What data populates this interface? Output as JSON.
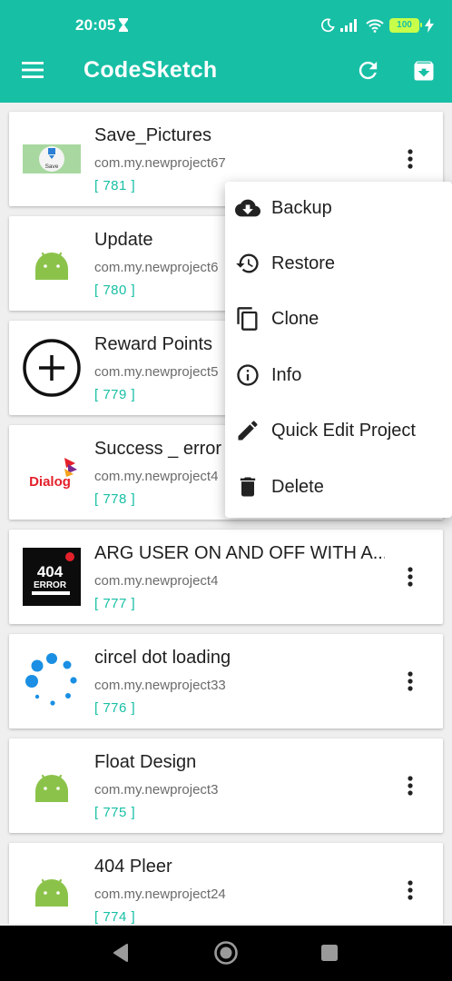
{
  "status": {
    "time": "20:05",
    "battery": "100"
  },
  "app": {
    "title": "CodeSketch"
  },
  "projects": [
    {
      "name": "Save_Pictures",
      "pkg": "com.my.newproject67",
      "id": "[ 781 ]",
      "icon": "save-picture-thumb"
    },
    {
      "name": "Update",
      "pkg": "com.my.newproject6",
      "id": "[ 780 ]",
      "icon": "android-icon"
    },
    {
      "name": "Reward Points",
      "pkg": "com.my.newproject5",
      "id": "[ 779 ]",
      "icon": "add-circle-icon"
    },
    {
      "name": "Success _ error",
      "pkg": "com.my.newproject4",
      "id": "[ 778 ]",
      "icon": "dialog-logo"
    },
    {
      "name": "ARG USER ON AND OFF WITH A...",
      "pkg": "com.my.newproject4",
      "id": "[ 777 ]",
      "icon": "404-error-thumb"
    },
    {
      "name": "circel dot loading",
      "pkg": "com.my.newproject33",
      "id": "[ 776 ]",
      "icon": "dot-loading-icon"
    },
    {
      "name": "Float Design",
      "pkg": "com.my.newproject3",
      "id": "[ 775 ]",
      "icon": "android-icon"
    },
    {
      "name": "404 Pleer",
      "pkg": "com.my.newproject24",
      "id": "[ 774 ]",
      "icon": "android-icon"
    }
  ],
  "thumb_text": {
    "save": "Save",
    "dialog": "Dialog",
    "err_404": "404",
    "err_word": "ERROR"
  },
  "menu": {
    "backup": "Backup",
    "restore": "Restore",
    "clone": "Clone",
    "info": "Info",
    "quick_edit": "Quick Edit Project",
    "delete": "Delete"
  },
  "colors": {
    "primary": "#17bfa5",
    "android_green": "#8bc34a",
    "dialog_red": "#e4202a"
  }
}
